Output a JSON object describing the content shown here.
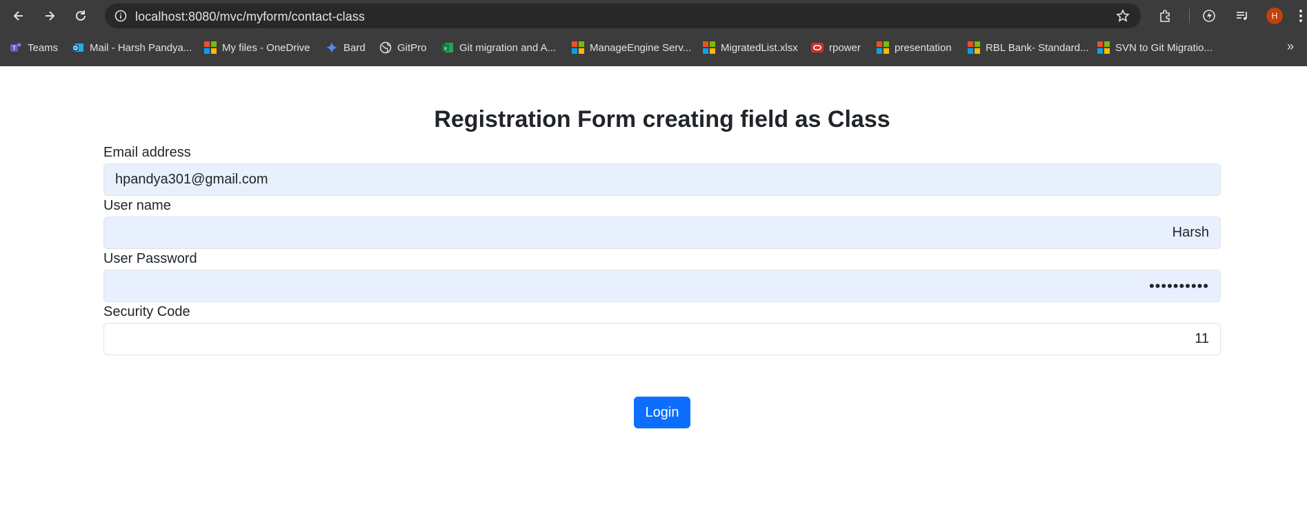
{
  "browser": {
    "url": "localhost:8080/mvc/myform/contact-class",
    "avatar_letter": "H",
    "bookmarks": [
      {
        "label": "Teams",
        "icon": "teams-icon"
      },
      {
        "label": "Mail - Harsh Pandya...",
        "icon": "outlook-icon"
      },
      {
        "label": "My files - OneDrive",
        "icon": "microsoft-icon"
      },
      {
        "label": "Bard",
        "icon": "bard-icon"
      },
      {
        "label": "GitPro",
        "icon": "globe-icon"
      },
      {
        "label": "Git migration and A...",
        "icon": "excel-icon"
      },
      {
        "label": "ManageEngine Serv...",
        "icon": "microsoft-icon"
      },
      {
        "label": "MigratedList.xlsx",
        "icon": "microsoft-icon"
      },
      {
        "label": "rpower",
        "icon": "oracle-icon"
      },
      {
        "label": "presentation",
        "icon": "microsoft-icon"
      },
      {
        "label": "RBL Bank- Standard...",
        "icon": "microsoft-icon"
      },
      {
        "label": "SVN to Git Migratio...",
        "icon": "microsoft-icon"
      }
    ]
  },
  "form": {
    "title": "Registration Form creating field as Class",
    "email": {
      "label": "Email address",
      "value": "hpandya301@gmail.com"
    },
    "username": {
      "label": "User name",
      "value": "Harsh"
    },
    "password": {
      "label": "User Password",
      "value": "••••••••••"
    },
    "security": {
      "label": "Security Code",
      "value": "11"
    },
    "submit_label": "Login"
  },
  "colors": {
    "primary": "#0d6efd",
    "autofill": "#e8f0fe",
    "browser_chrome": "#3c3c3c"
  }
}
